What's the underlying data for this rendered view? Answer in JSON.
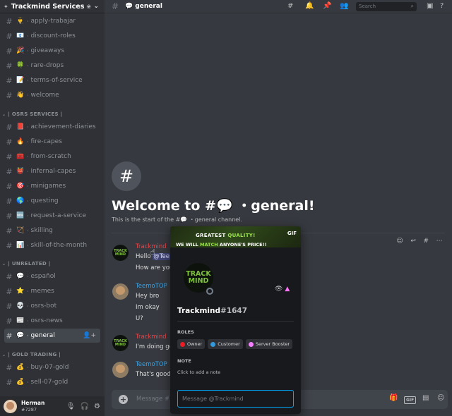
{
  "server": {
    "name": "Trackmind Services"
  },
  "sidebar": {
    "channels_top": [
      {
        "emoji": "👨‍✈️",
        "name": "apply-trabajar"
      },
      {
        "emoji": "📧",
        "name": "discount-roles"
      },
      {
        "emoji": "🎉",
        "name": "giveaways"
      },
      {
        "emoji": "🍀",
        "name": "rare-drops"
      },
      {
        "emoji": "📝",
        "name": "terms-of-service"
      },
      {
        "emoji": "👋",
        "name": "welcome"
      }
    ],
    "cat_osrs": "| OSRS SERVICES |",
    "channels_osrs": [
      {
        "emoji": "📕",
        "name": "achievement-diaries"
      },
      {
        "emoji": "🔥",
        "name": "fire-capes"
      },
      {
        "emoji": "🧰",
        "name": "from-scratch"
      },
      {
        "emoji": "👹",
        "name": "infernal-capes"
      },
      {
        "emoji": "🎯",
        "name": "minigames"
      },
      {
        "emoji": "🌎",
        "name": "questing"
      },
      {
        "emoji": "🆕",
        "name": "request-a-service"
      },
      {
        "emoji": "🏹",
        "name": "skilling"
      },
      {
        "emoji": "📊",
        "name": "skill-of-the-month"
      }
    ],
    "cat_unrelated": "| UNRELATED |",
    "channels_unrelated": [
      {
        "emoji": "💬",
        "name": "español"
      },
      {
        "emoji": "⭐",
        "name": "memes"
      },
      {
        "emoji": "💀",
        "name": "osrs-bot"
      },
      {
        "emoji": "📰",
        "name": "osrs-news"
      },
      {
        "emoji": "💬",
        "name": "general"
      }
    ],
    "cat_gold": "| GOLD TRADING |",
    "channels_gold": [
      {
        "emoji": "💰",
        "name": "buy-07-gold"
      },
      {
        "emoji": "💰",
        "name": "sell-07-gold"
      }
    ]
  },
  "user": {
    "name": "Herman",
    "tag": "#7287"
  },
  "topbar": {
    "channel_emoji": "💬",
    "channel_name": "general",
    "search_placeholder": "Search"
  },
  "welcome": {
    "title": "Welcome to #💬 ・general!",
    "subtitle": "This is the start of the #💬 ・general channel."
  },
  "messages": [
    {
      "author": "Trackmind",
      "lines": [
        "Hello @Tee",
        "How are you"
      ]
    },
    {
      "author": "TeemoTOP",
      "lines": [
        "Hey bro",
        "Im okay",
        "U?"
      ]
    },
    {
      "author": "Trackmind",
      "lines": [
        "I'm doing go"
      ]
    },
    {
      "author": "TeemoTOP",
      "lines": [
        "That's good,"
      ]
    }
  ],
  "composer": {
    "placeholder": "Message #💬"
  },
  "popout": {
    "banner_line1_a": "GREATEST ",
    "banner_line1_b": "QUALITY!",
    "banner_line2_a": "WE WILL ",
    "banner_line2_b": "MATCH",
    "banner_line2_c": " ANYONE'S PRICE!!",
    "banner_gif": "GIF",
    "avatar_text_1": "TRACK",
    "avatar_text_2": "MIND",
    "username": "Trackmind",
    "discriminator": "#1647",
    "roles_label": "ROLES",
    "roles": [
      {
        "name": "Owner",
        "color": "#ed1c24"
      },
      {
        "name": "Customer",
        "color": "#3498db"
      },
      {
        "name": "Server Booster",
        "color": "#f47fff"
      }
    ],
    "note_label": "NOTE",
    "note_placeholder": "Click to add a note",
    "dm_placeholder": "Message @Trackmind"
  },
  "avatar_label": "TRACK MIND",
  "colors": {
    "accent_red": "#ed4245",
    "accent_blue": "#3ba0e0",
    "focus": "#00a8fc"
  }
}
